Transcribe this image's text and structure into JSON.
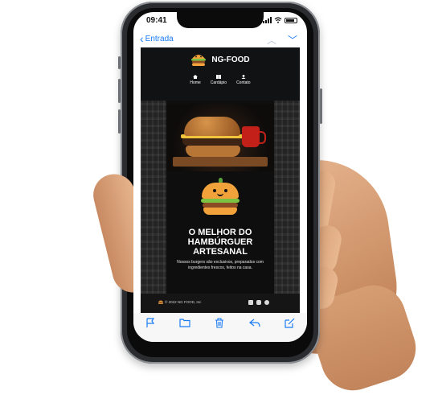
{
  "status_bar": {
    "time": "09:41"
  },
  "mail": {
    "back_label": "Entrada",
    "icons": {
      "back": "chevron-left-icon",
      "prev": "chevron-up-icon",
      "next": "chevron-down-icon"
    }
  },
  "email": {
    "brand": "NG-FOOD",
    "menu": [
      {
        "label": "Home",
        "icon": "home-icon"
      },
      {
        "label": "Cardápio",
        "icon": "menu-book-icon"
      },
      {
        "label": "Contato",
        "icon": "user-icon"
      }
    ],
    "headline": "O MELHOR DO HAMBÚRGUER ARTESANAL",
    "subtext": "Nossos burgers são exclusivos, preparados com ingredientes frescos, feitos na casa.",
    "footer_copy": "© 2022 NG FOOD, Inc",
    "social_icons": [
      "facebook-icon",
      "instagram-icon",
      "twitter-icon"
    ]
  },
  "toolbar": {
    "icons": [
      "flag-icon",
      "folder-icon",
      "trash-icon",
      "reply-icon",
      "compose-icon"
    ]
  },
  "colors": {
    "accent": "#1a7cf5",
    "email_bg": "#111213"
  }
}
